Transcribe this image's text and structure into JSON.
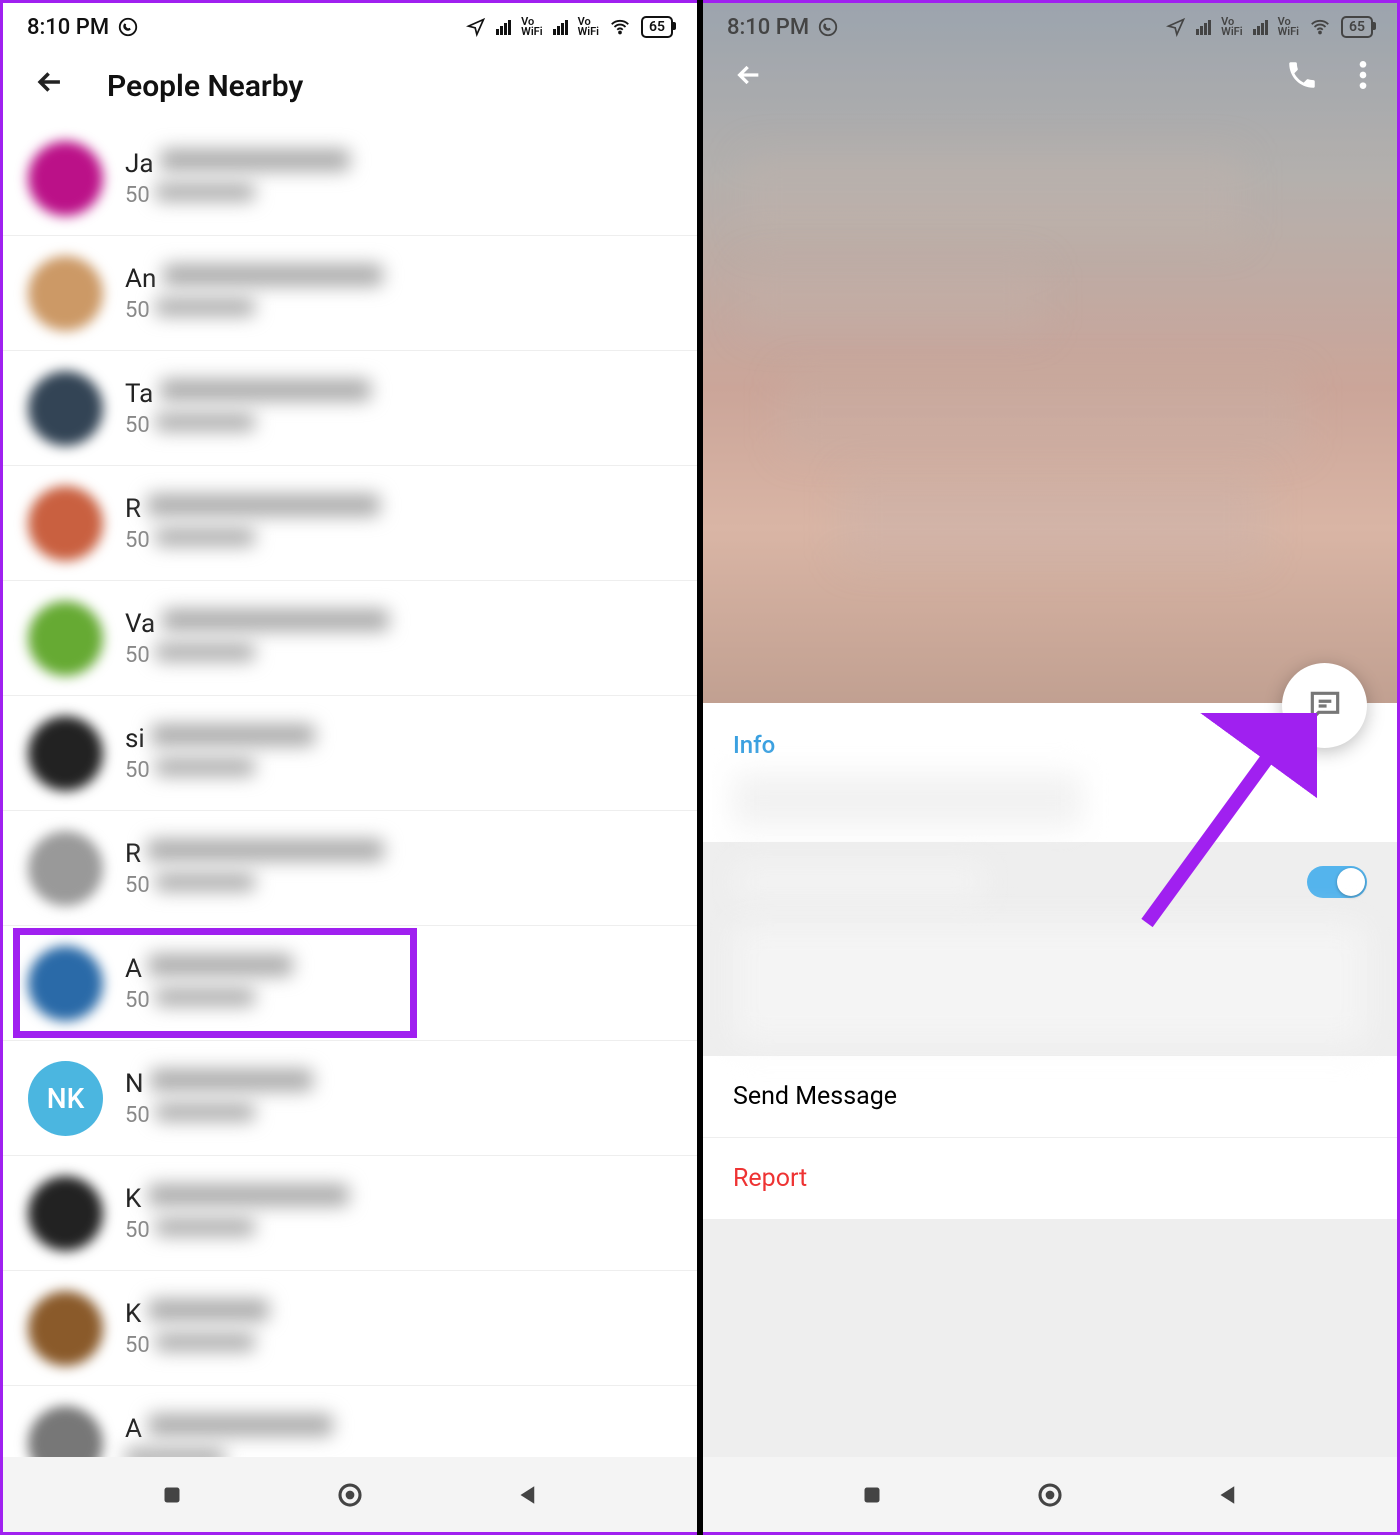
{
  "status": {
    "time": "8:10 PM",
    "battery": "65"
  },
  "left": {
    "title": "People Nearby",
    "items": [
      {
        "prefix": "Ja",
        "sub": "50",
        "color": "#b18"
      },
      {
        "prefix": "An",
        "sub": "50",
        "color": "#c96"
      },
      {
        "prefix": "Ta",
        "sub": "50",
        "color": "#345"
      },
      {
        "prefix": "R",
        "sub": "50",
        "color": "#c96040"
      },
      {
        "prefix": "Va",
        "sub": "50",
        "color": "#6a3"
      },
      {
        "prefix": "si",
        "sub": "50",
        "color": "#222"
      },
      {
        "prefix": "R",
        "sub": "50",
        "color": "#999"
      },
      {
        "prefix": "A",
        "sub": "50",
        "color": "#2a6aa8",
        "highlighted": true
      },
      {
        "prefix": "N",
        "sub": "50",
        "color": "#4bb6e0",
        "initials": "NK"
      },
      {
        "prefix": "K",
        "sub": "50",
        "color": "#222"
      },
      {
        "prefix": "K",
        "sub": "50",
        "color": "#8a5a2a"
      },
      {
        "prefix": "A",
        "sub": "",
        "color": "#777"
      }
    ]
  },
  "right": {
    "info_label": "Info",
    "send_message": "Send Message",
    "report": "Report",
    "toggle_on": true
  }
}
